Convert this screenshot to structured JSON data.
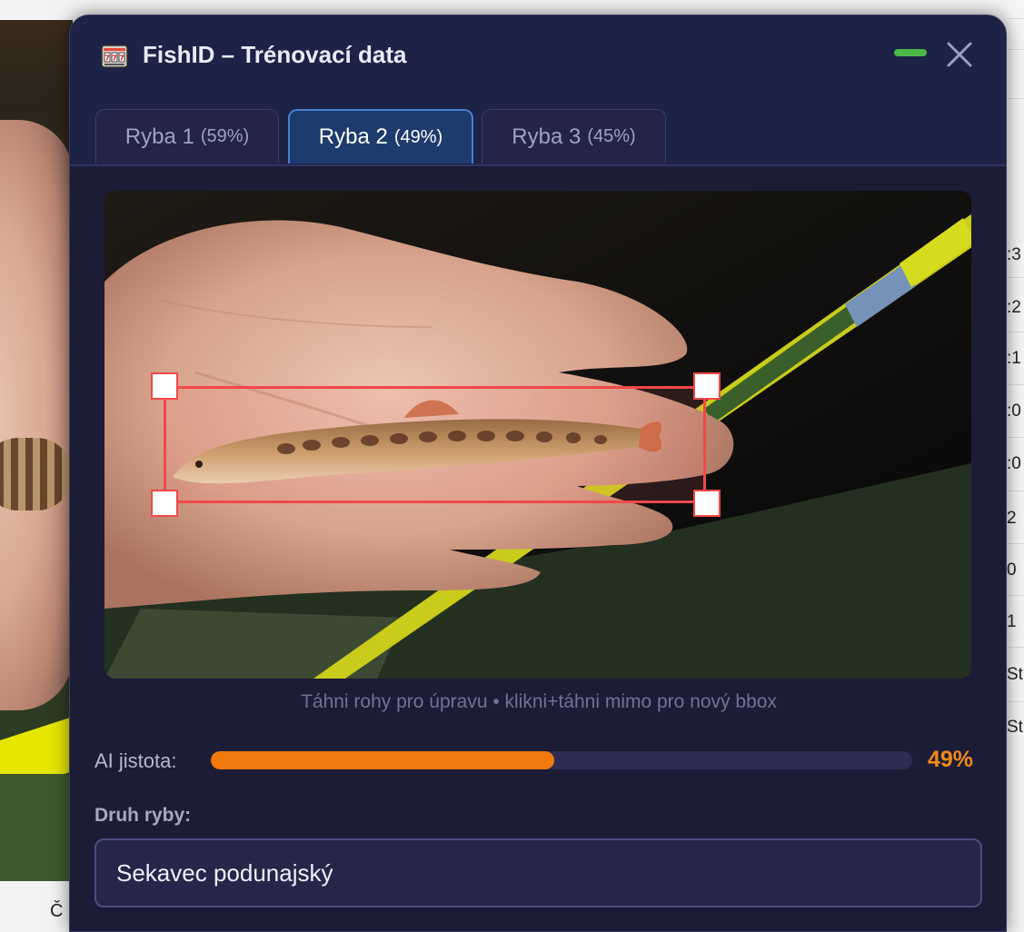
{
  "window": {
    "title": "FishID – Trénovací data",
    "icon": "slot-machine-icon"
  },
  "tabs": [
    {
      "label": "Ryba 1",
      "percent": "(59%)",
      "active": false
    },
    {
      "label": "Ryba 2",
      "percent": "(49%)",
      "active": true
    },
    {
      "label": "Ryba 3",
      "percent": "(45%)",
      "active": false
    }
  ],
  "image": {
    "hint": "Táhni rohy pro úpravu • klikni+táhni mimo pro nový bbox"
  },
  "confidence": {
    "label": "AI jistota:",
    "value_text": "49%",
    "value": 0.49,
    "color": "#f07a0c"
  },
  "species": {
    "label": "Druh ryby:",
    "value": "Sekavec podunajský"
  },
  "background": {
    "right_strip_rows": [
      ":3",
      ":2",
      ":1",
      ":0",
      ":0",
      "2",
      "0",
      "1",
      "St",
      "St"
    ],
    "bottom_text": "Č"
  },
  "colors": {
    "accent_blue": "#4a7fd0",
    "bbox_red": "#f24848",
    "minimize_green": "#4cb848"
  }
}
